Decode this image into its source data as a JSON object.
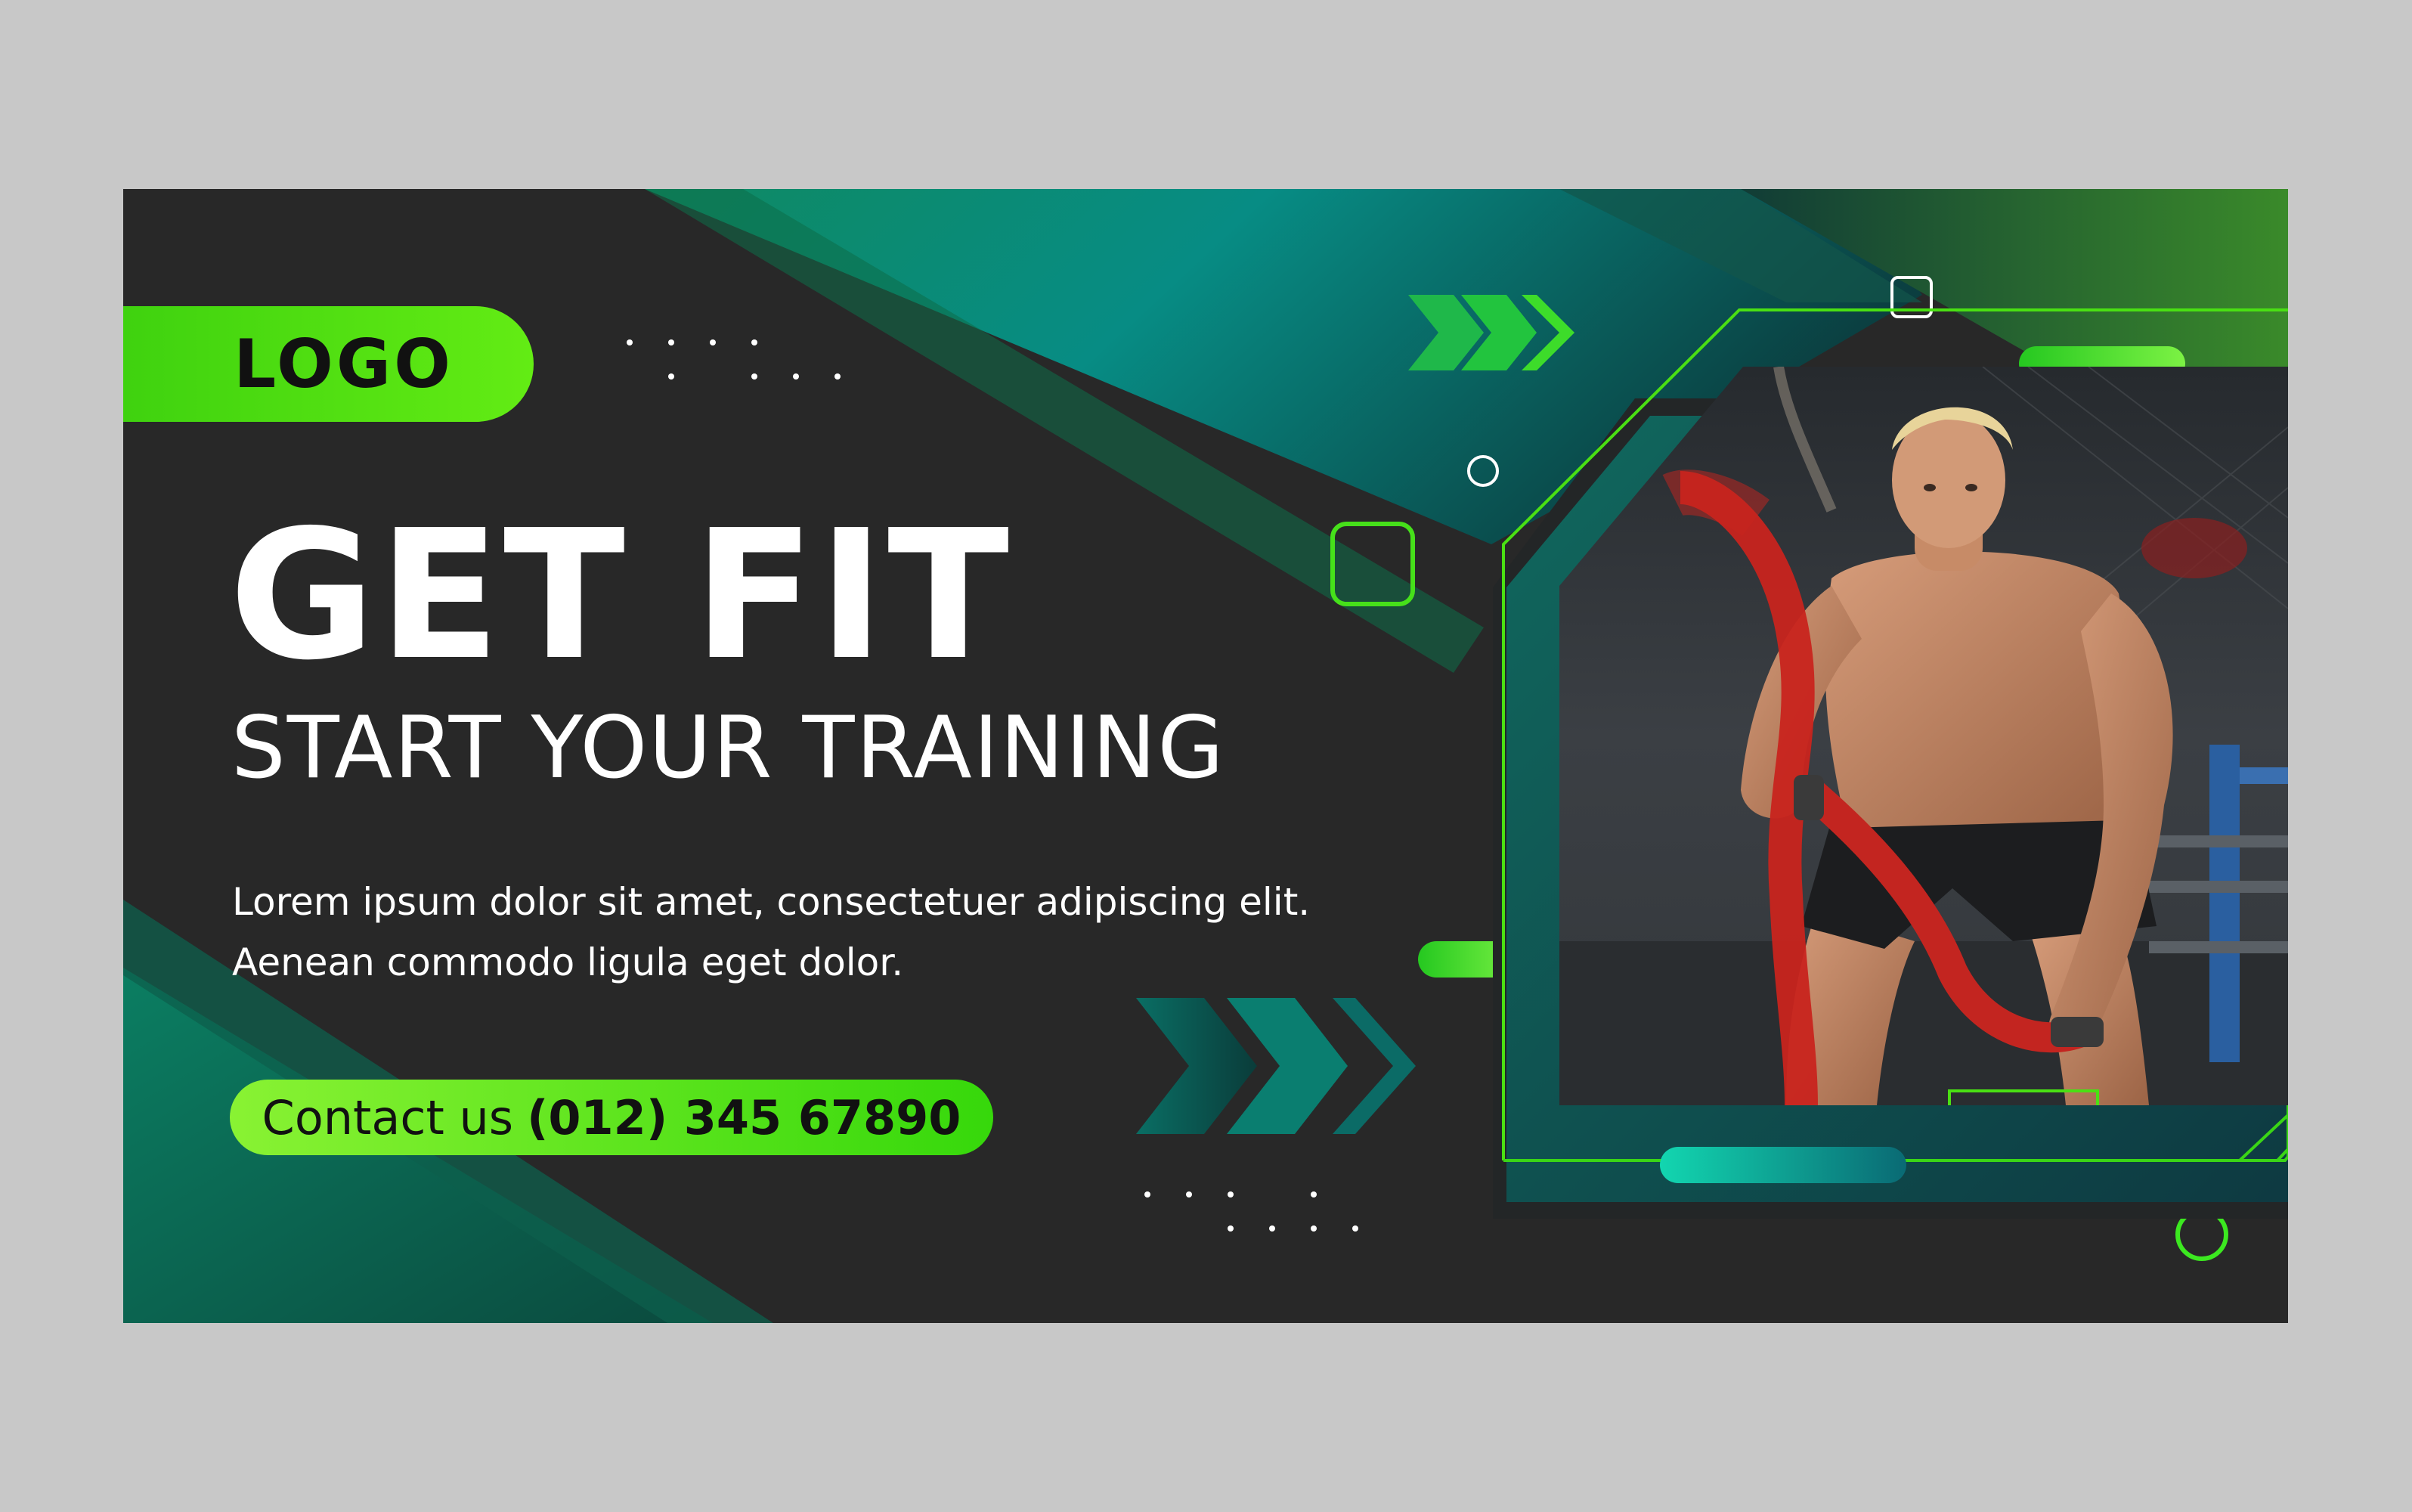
{
  "logo": {
    "text": "LOGO"
  },
  "headline": "GET FIT",
  "subheadline": "START YOUR TRAINING",
  "body": {
    "line1": "Lorem ipsum dolor sit amet, consectetuer adipiscing elit.",
    "line2": "Aenean commodo ligula eget dolor."
  },
  "contact": {
    "label": "Contact us",
    "phone": "(012) 345 67890"
  },
  "photo": {
    "subject": "athlete-with-battle-ropes"
  },
  "colors": {
    "background": "#2a2a2a",
    "page": "#c8c8c8",
    "accent_green": "#4ae013",
    "accent_teal": "#0d8f78",
    "text": "#ffffff",
    "text_dark": "#111111",
    "rope": "#c8241d"
  }
}
